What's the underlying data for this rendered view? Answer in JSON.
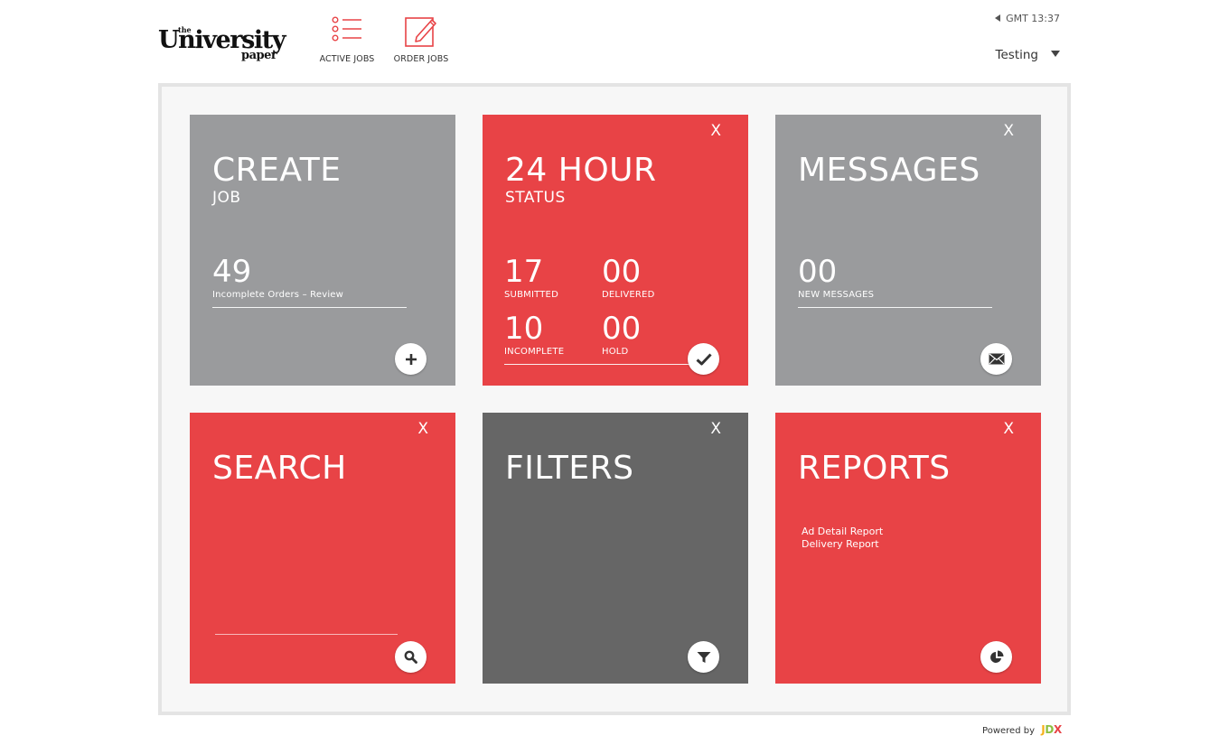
{
  "header": {
    "logo": {
      "the": "the",
      "university": "University",
      "paper": "paper"
    },
    "nav": [
      {
        "label": "ACTIVE JOBS",
        "icon": "list-icon"
      },
      {
        "label": "ORDER JOBS",
        "icon": "edit-icon"
      }
    ],
    "clock": "GMT 13:37",
    "user": "Testing"
  },
  "colors": {
    "accent": "#e84346",
    "grey_tile": "#9a9b9d",
    "dark_tile": "#666666",
    "frame": "#e4e4e4"
  },
  "tiles": {
    "create": {
      "title": "CREATE",
      "subtitle": "JOB",
      "count": "49",
      "count_label": "Incomplete Orders – Review",
      "button_icon": "plus-icon"
    },
    "status": {
      "title": "24 HOUR",
      "subtitle": "STATUS",
      "close": "X",
      "submitted": {
        "value": "17",
        "label": "SUBMITTED"
      },
      "delivered": {
        "value": "00",
        "label": "DELIVERED"
      },
      "incomplete": {
        "value": "10",
        "label": "INCOMPLETE"
      },
      "hold": {
        "value": "00",
        "label": "HOLD"
      },
      "button_icon": "check-icon"
    },
    "messages": {
      "title": "MESSAGES",
      "close": "X",
      "count": "00",
      "count_label": "NEW MESSAGES",
      "button_icon": "envelope-icon"
    },
    "search": {
      "title": "SEARCH",
      "close": "X",
      "button_icon": "search-icon"
    },
    "filters": {
      "title": "FILTERS",
      "close": "X",
      "button_icon": "filter-icon"
    },
    "reports": {
      "title": "REPORTS",
      "close": "X",
      "links": [
        "Ad Detail Report",
        "Delivery Report"
      ],
      "button_icon": "pie-chart-icon"
    }
  },
  "footer": {
    "powered_by": "Powered by",
    "brand": {
      "j": "J",
      "d": "D",
      "x": "X"
    }
  }
}
